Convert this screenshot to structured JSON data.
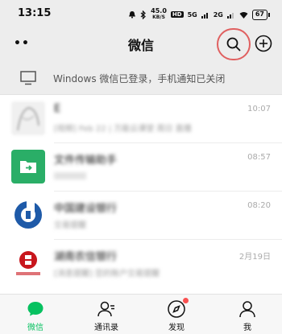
{
  "status_bar": {
    "time": "13:15",
    "speed": "45.0",
    "speed_unit": "KB/S",
    "hd": "HD",
    "signal_a": "5G",
    "signal_b": "2G",
    "battery": "67"
  },
  "header": {
    "title": "微信",
    "menu_dots": "••"
  },
  "banner": {
    "text": "Windows 微信已登录，手机通知已关闭"
  },
  "chats": [
    {
      "name": "E",
      "preview": "[视频] Feb 22 | 万能云课堂 周日 直播",
      "time": "10:07"
    },
    {
      "name": "文件传输助手",
      "preview": "",
      "time": "08:57"
    },
    {
      "name": "中国建设银行",
      "preview": "交易提醒",
      "time": "08:20"
    },
    {
      "name": "湖南农信银行",
      "preview": "[消息提醒] 您的账户交易提醒",
      "time": "2月19日"
    }
  ],
  "nav": [
    {
      "label": "微信",
      "icon": "chat-icon",
      "active": true
    },
    {
      "label": "通讯录",
      "icon": "contacts-icon",
      "active": false
    },
    {
      "label": "发现",
      "icon": "compass-icon",
      "active": false
    },
    {
      "label": "我",
      "icon": "person-icon",
      "active": false
    }
  ],
  "colors": {
    "accent": "#07c160",
    "highlight_ring": "#e06060",
    "file_helper": "#2aae67",
    "ccb_blue": "#1e5aa8",
    "bank_red": "#c8161d"
  }
}
